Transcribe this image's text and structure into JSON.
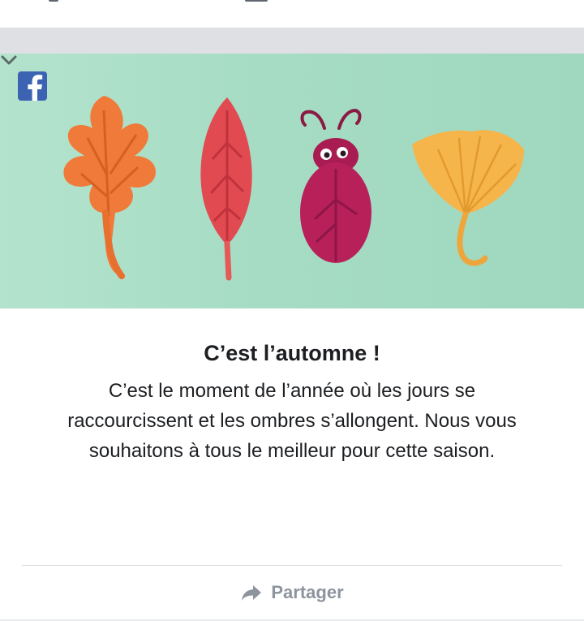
{
  "post": {
    "source": "facebook-logo-icon",
    "title": "C’est l’automne !",
    "body": "C’est le moment de l’année où les jours se raccourcissent et les ombres s’allongent. Nous vous souhaitons à tous le meilleur pour cette saison.",
    "share_label": "Partager"
  },
  "icons": {
    "menu": "chevron-down-icon",
    "share": "share-arrow-icon"
  },
  "colors": {
    "hero_background": "#a6dcc4",
    "facebook_blue": "#3b63b2",
    "orange_leaf": "#f07a3a",
    "red_leaf": "#e24a52",
    "beetle": "#b8205a",
    "ginkgo_leaf": "#f6b54a",
    "muted_text": "#8d949e"
  }
}
